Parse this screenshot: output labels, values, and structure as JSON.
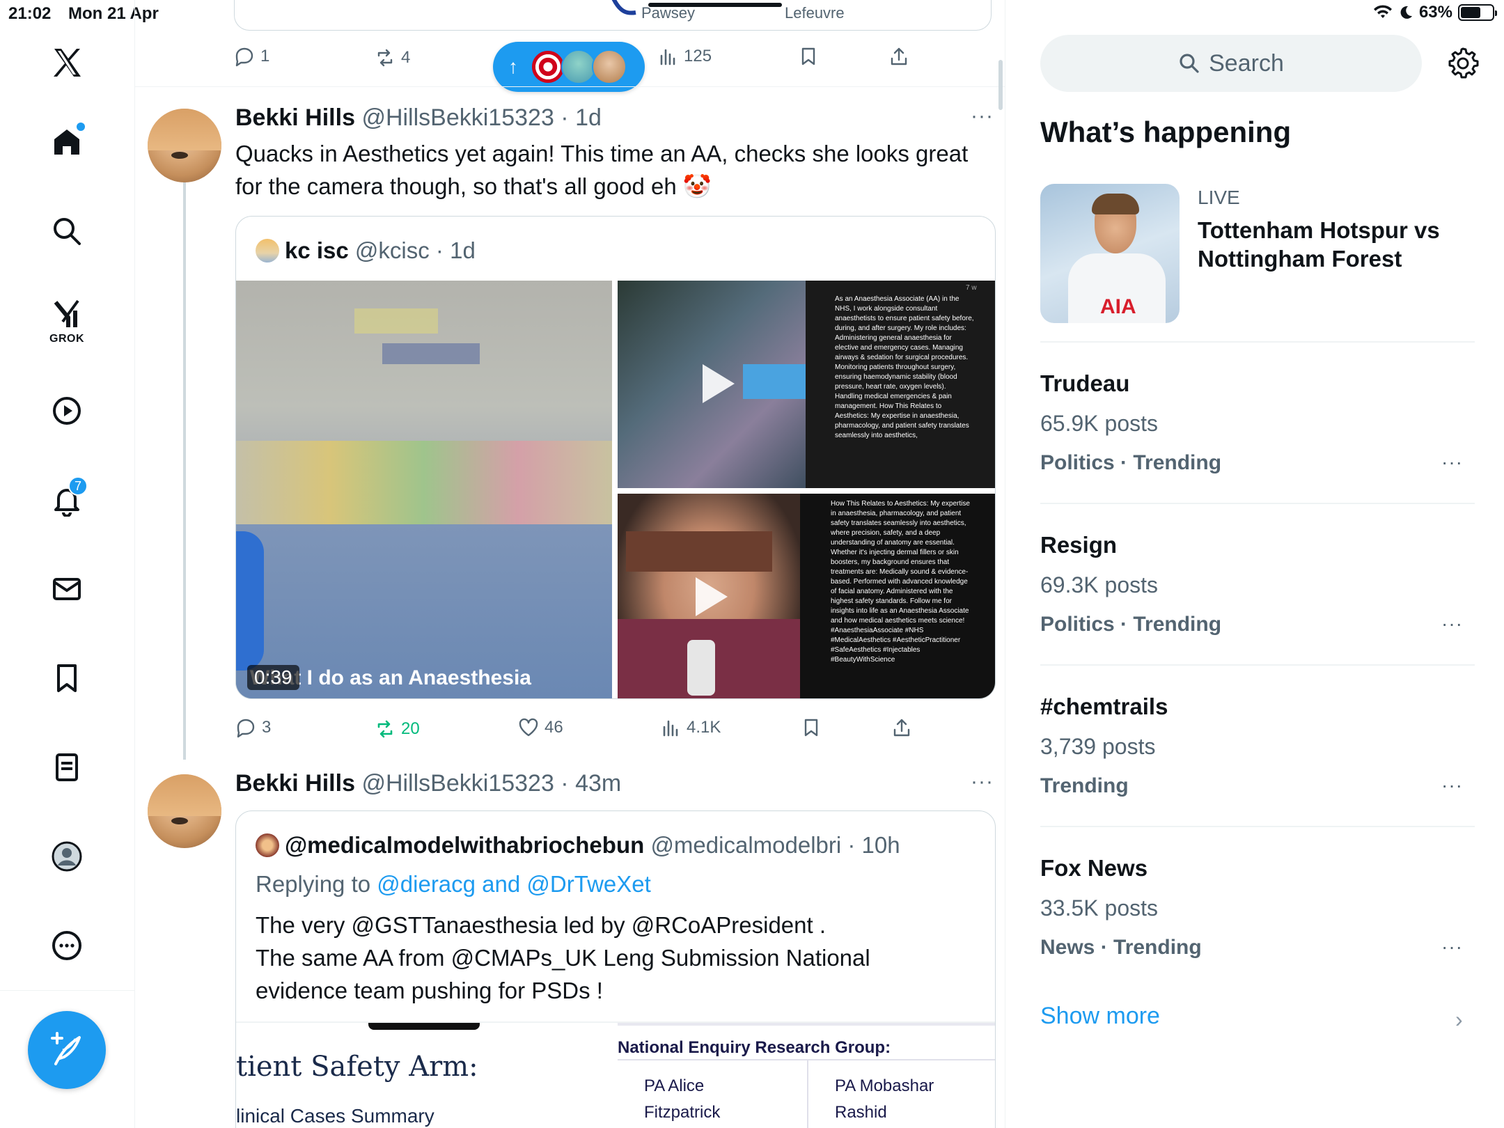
{
  "status": {
    "time": "21:02",
    "date": "Mon 21 Apr",
    "battery": "63%",
    "battery_level": 0.63
  },
  "nav": {
    "grok_label": "GROK",
    "notifications_badge": "7",
    "items": [
      "x-logo",
      "home",
      "search",
      "grok",
      "videos",
      "notifications",
      "messages",
      "bookmarks",
      "lists",
      "profile",
      "more"
    ]
  },
  "top_tweet": {
    "card_text_left": "Pawsey",
    "card_text_right": "Lefeuvre",
    "replies": "1",
    "reposts": "4",
    "views": "125"
  },
  "new_posts_pill": {
    "arrow": "↑"
  },
  "tweet1": {
    "name": "Bekki Hills",
    "handle": "@HillsBekki15323",
    "time": "1d",
    "text_line1": "Quacks in Aesthetics yet again! This time an AA, checks she looks great",
    "text_line2": "for the camera though, so that's all good eh 🤡",
    "quote": {
      "name": "kc isc",
      "handle": "@kcisc",
      "time": "1d",
      "video_duration": "0:39",
      "overlay_caption": "What I do as an Anaesthesia",
      "overlay1": "As an Anaesthesia Associate (AA) in the NHS, I work alongside consultant anaesthetists to ensure patient safety before, during, and after surgery. My role includes: Administering general anaesthesia for elective and emergency cases. Managing airways & sedation for surgical procedures. Monitoring patients throughout surgery, ensuring haemodynamic stability (blood pressure, heart rate, oxygen levels). Handling medical emergencies & pain management. How This Relates to Aesthetics: My expertise in anaesthesia, pharmacology, and patient safety translates seamlessly into aesthetics,",
      "overlay1_timestamp": "7 w",
      "overlay2": "How This Relates to Aesthetics: My expertise in anaesthesia, pharmacology, and patient safety translates seamlessly into aesthetics, where precision, safety, and a deep understanding of anatomy are essential. Whether it's injecting dermal fillers or skin boosters, my background ensures that treatments are: Medically sound & evidence-based. Performed with advanced knowledge of facial anatomy. Administered with the highest safety standards. Follow me for insights into life as an Anaesthesia Associate and how medical aesthetics meets science! #AnaesthesiaAssociate #NHS #MedicalAesthetics #AestheticPractitioner #SafeAesthetics #Injectables #BeautyWithScience"
    },
    "replies": "3",
    "reposts": "20",
    "likes": "46",
    "views": "4.1K"
  },
  "tweet2": {
    "name": "Bekki Hills",
    "handle": "@HillsBekki15323",
    "time": "43m",
    "quote": {
      "name": "@medicalmodelwithabriochebun",
      "handle": "@medicalmodelbri",
      "time": "10h",
      "replying_prefix": "Replying to",
      "replying_to": "@dieracg and @DrTweXet",
      "text_line1": "The very @GSTTanaesthesia led by @RCoAPresident .",
      "text_line2": "The same AA from @CMAPs_UK Leng Submission National",
      "text_line3": "evidence team pushing for PSDs !",
      "img_left_title": "tient Safety Arm:",
      "img_left_sub": "linical Cases Summary",
      "img_right_title": "National Enquiry Research Group:",
      "img_right_col1a": "PA Alice",
      "img_right_col1b": "Fitzpatrick",
      "img_right_col2a": "PA Mobashar",
      "img_right_col2b": "Rashid"
    }
  },
  "sidebar": {
    "search_placeholder": "Search",
    "section_title": "What’s happening",
    "live": {
      "label": "LIVE",
      "title": "Tottenham Hotspur vs Nottingham Forest",
      "shirt_text": "AIA"
    },
    "trends": [
      {
        "name": "Trudeau",
        "posts": "65.9K posts",
        "category": "Politics · Trending"
      },
      {
        "name": "Resign",
        "posts": "69.3K posts",
        "category": "Politics · Trending"
      },
      {
        "name": "#chemtrails",
        "posts": "3,739 posts",
        "category": "Trending"
      },
      {
        "name": "Fox News",
        "posts": "33.5K posts",
        "category": "News · Trending"
      }
    ],
    "show_more": "Show more"
  },
  "colors": {
    "accent": "#1d9bf0",
    "repost_active": "#00ba7c",
    "secondary_text": "#536471",
    "border": "#cfd9de"
  }
}
